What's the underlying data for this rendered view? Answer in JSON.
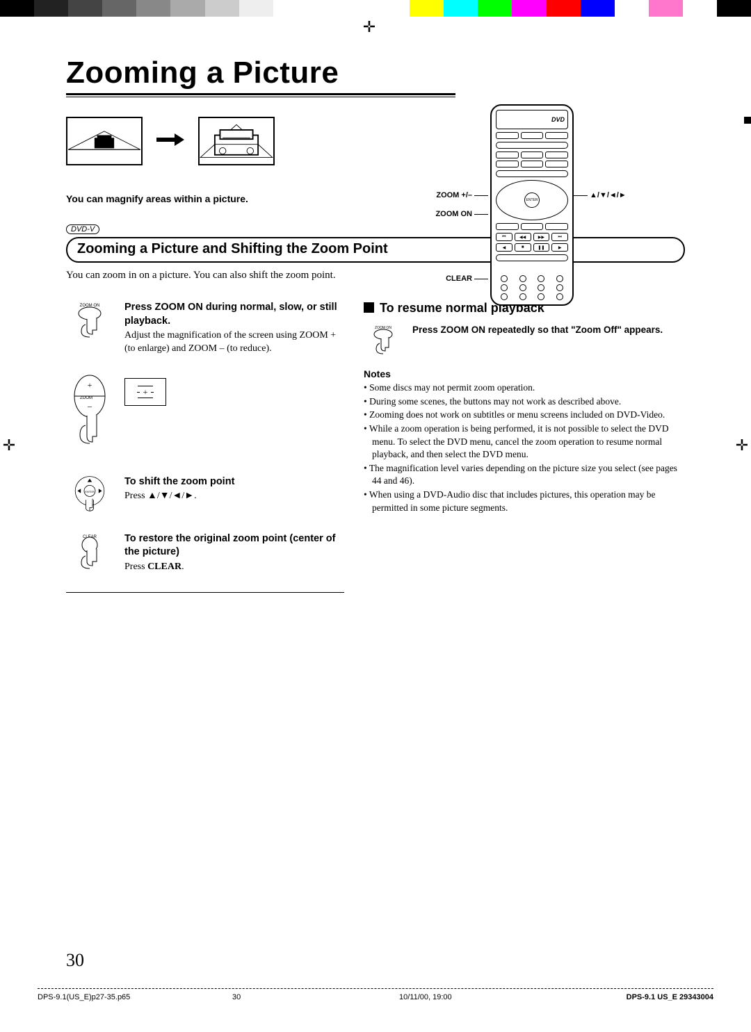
{
  "color_strip_top": [
    "#000",
    "#222",
    "#444",
    "#666",
    "#888",
    "#aaa",
    "#ccc",
    "#eee",
    "#fff",
    "#fff",
    "#fff",
    "#fff",
    "#ff0",
    "#0ff",
    "#0f0",
    "#f0f",
    "#f00",
    "#00f",
    "#fff",
    "#f7c",
    "#fff",
    "#000"
  ],
  "title": "Zooming a Picture",
  "intro_caption": "You can magnify areas within a picture.",
  "dvd_badge": "DVD-V",
  "section_heading": "Zooming a Picture and Shifting the Zoom Point",
  "lead": "You can zoom in on a picture. You can also shift the zoom point.",
  "remote_labels": {
    "zoom_pm": "ZOOM +/–",
    "zoom_on": "ZOOM ON",
    "clear": "CLEAR",
    "arrows": "▲/▼/◄/►",
    "enter": "ENTER",
    "dvd": "DVD"
  },
  "left_steps": {
    "s1_hd": "Press ZOOM ON during normal, slow, or still playback.",
    "s1_body_a": "Adjust the magnification of the screen using ZOOM + (to enlarge) and ZOOM – (to reduce).",
    "s1_icon_label": "ZOOM ON",
    "zoom_btn_label": "ZOOM",
    "plus_symbol": "+",
    "s2_hd": "To shift the zoom point",
    "s2_body": "Press ▲/▼/◄/►.",
    "s2_icon_label": "ENTER",
    "s3_hd": "To restore the original zoom point (center of the picture)",
    "s3_body_a": "Press ",
    "s3_body_b": "CLEAR",
    "s3_body_c": ".",
    "s3_icon_label": "CLEAR"
  },
  "right": {
    "resume_hd": "To resume normal playback",
    "resume_icon_label": "ZOOM ON",
    "resume_text": "Press ZOOM ON repeatedly so that \"Zoom Off\" appears.",
    "notes_hd": "Notes",
    "notes": [
      "Some discs may not permit zoom operation.",
      "During some scenes, the buttons may not work as described above.",
      "Zooming does not work on subtitles or menu screens included on DVD-Video.",
      "While a zoom operation is being performed, it is not possible to select the DVD menu. To select the DVD menu, cancel the zoom operation to resume normal playback, and then select the DVD menu.",
      "The magnification level varies depending on the picture size you select (see pages 44 and 46).",
      "When using a DVD-Audio disc that includes pictures, this operation may be permitted in some picture segments."
    ]
  },
  "page_number": "30",
  "footer": {
    "file": "DPS-9.1(US_E)p27-35.p65",
    "page": "30",
    "timestamp": "10/11/00, 19:00",
    "doc_id": "DPS-9.1 US_E   29343004"
  }
}
